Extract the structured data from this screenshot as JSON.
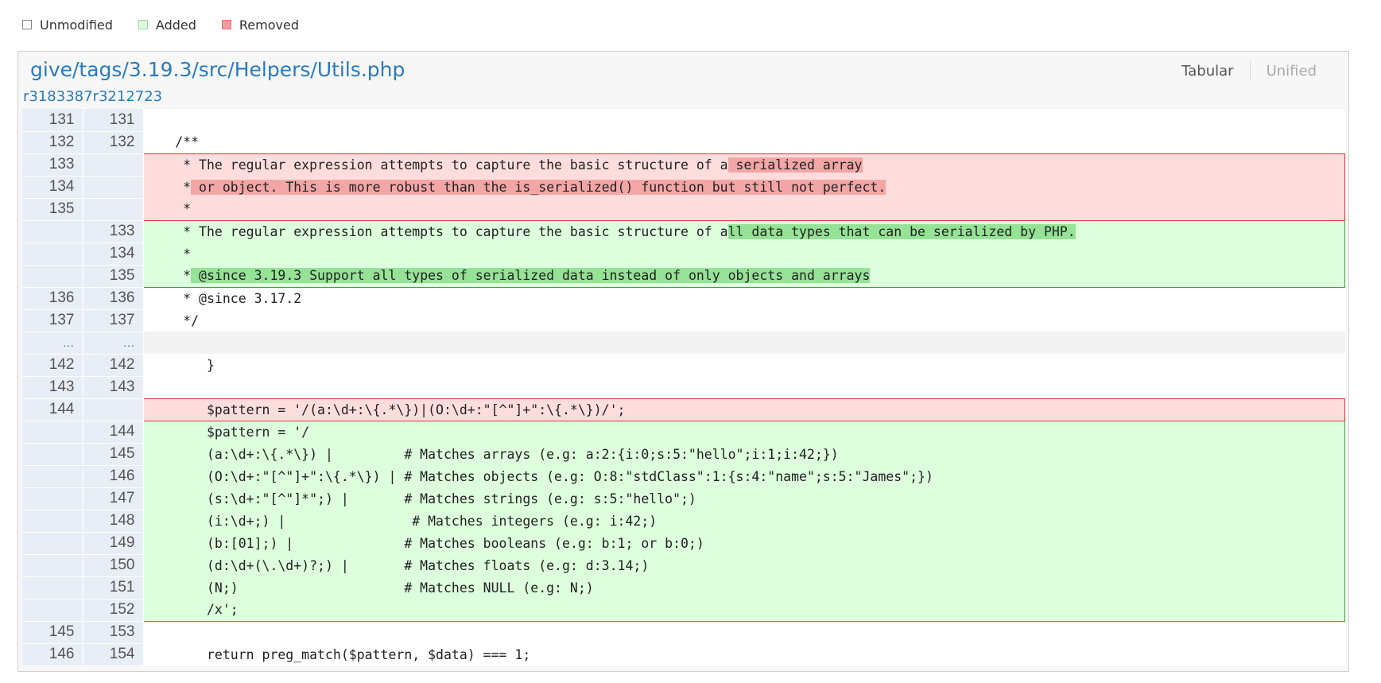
{
  "legend": {
    "unmodified": "Unmodified",
    "added": "Added",
    "removed": "Removed"
  },
  "file": {
    "path": "give/tags/3.19.3/src/Helpers/Utils.php",
    "revisions": "r3183387r3212723"
  },
  "view": {
    "tabular": "Tabular",
    "unified": "Unified"
  },
  "colors": {
    "link": "#2a7bbd",
    "added_bg": "#ddffdd",
    "added_border": "#39a839",
    "removed_bg": "#ffdddd",
    "removed_border": "#d83a3a"
  },
  "rows": [
    {
      "old": "131",
      "new": "131",
      "type": "ctx",
      "code": ""
    },
    {
      "old": "132",
      "new": "132",
      "type": "ctx",
      "code": "    /**"
    },
    {
      "old": "133",
      "new": "",
      "type": "rem",
      "pre": "     * The regular expression attempts to capture the basic structure of a",
      "hl": " serialized array",
      "post": ""
    },
    {
      "old": "134",
      "new": "",
      "type": "rem",
      "pre": "     *",
      "hl": " or object. This is more robust than the is_serialized() function but still not perfect.",
      "post": ""
    },
    {
      "old": "135",
      "new": "",
      "type": "rem",
      "pre": "     *",
      "hl": "",
      "post": ""
    },
    {
      "old": "",
      "new": "133",
      "type": "add",
      "pre": "     * The regular expression attempts to capture the basic structure of a",
      "hl": "ll data types that can be serialized by PHP.",
      "post": ""
    },
    {
      "old": "",
      "new": "134",
      "type": "add",
      "pre": "     *",
      "hl": "",
      "post": ""
    },
    {
      "old": "",
      "new": "135",
      "type": "add",
      "pre": "     *",
      "hl": " @since 3.19.3 Support all types of serialized data instead of only objects and arrays",
      "post": ""
    },
    {
      "old": "136",
      "new": "136",
      "type": "ctx",
      "code": "     * @since 3.17.2"
    },
    {
      "old": "137",
      "new": "137",
      "type": "ctx",
      "code": "     */"
    },
    {
      "old": "…",
      "new": "…",
      "type": "skip",
      "code": ""
    },
    {
      "old": "142",
      "new": "142",
      "type": "ctx",
      "code": "        }"
    },
    {
      "old": "143",
      "new": "143",
      "type": "ctx",
      "code": ""
    },
    {
      "old": "144",
      "new": "",
      "type": "rem",
      "pre": "        $pattern = '/(a:\\d+:\\{.*\\})|(O:\\d+:\"[^\"]+\":\\{.*\\})/';",
      "hl": "",
      "post": ""
    },
    {
      "old": "",
      "new": "144",
      "type": "add",
      "pre": "        $pattern = '/",
      "hl": "",
      "post": ""
    },
    {
      "old": "",
      "new": "145",
      "type": "add",
      "pre": "        (a:\\d+:\\{.*\\}) |         # Matches arrays (e.g: a:2:{i:0;s:5:\"hello\";i:1;i:42;})",
      "hl": "",
      "post": ""
    },
    {
      "old": "",
      "new": "146",
      "type": "add",
      "pre": "        (O:\\d+:\"[^\"]+\":\\{.*\\}) | # Matches objects (e.g: O:8:\"stdClass\":1:{s:4:\"name\";s:5:\"James\";})",
      "hl": "",
      "post": ""
    },
    {
      "old": "",
      "new": "147",
      "type": "add",
      "pre": "        (s:\\d+:\"[^\"]*\";) |       # Matches strings (e.g: s:5:\"hello\";)",
      "hl": "",
      "post": ""
    },
    {
      "old": "",
      "new": "148",
      "type": "add",
      "pre": "        (i:\\d+;) |                # Matches integers (e.g: i:42;)",
      "hl": "",
      "post": ""
    },
    {
      "old": "",
      "new": "149",
      "type": "add",
      "pre": "        (b:[01];) |              # Matches booleans (e.g: b:1; or b:0;)",
      "hl": "",
      "post": ""
    },
    {
      "old": "",
      "new": "150",
      "type": "add",
      "pre": "        (d:\\d+(\\.\\d+)?;) |       # Matches floats (e.g: d:3.14;)",
      "hl": "",
      "post": ""
    },
    {
      "old": "",
      "new": "151",
      "type": "add",
      "pre": "        (N;)                     # Matches NULL (e.g: N;)",
      "hl": "",
      "post": ""
    },
    {
      "old": "",
      "new": "152",
      "type": "add",
      "pre": "        /x';",
      "hl": "",
      "post": ""
    },
    {
      "old": "145",
      "new": "153",
      "type": "ctx",
      "code": ""
    },
    {
      "old": "146",
      "new": "154",
      "type": "ctx",
      "code": "        return preg_match($pattern, $data) === 1;"
    }
  ]
}
